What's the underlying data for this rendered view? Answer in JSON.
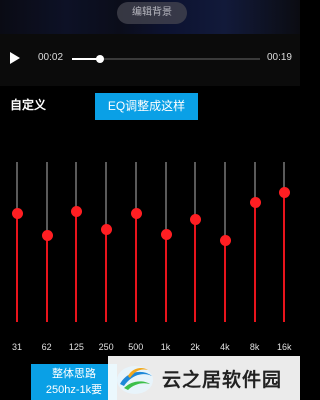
{
  "video": {
    "edit_background_label": "编辑背景"
  },
  "player": {
    "current_time": "00:02",
    "total_time": "00:19",
    "progress": 0.15
  },
  "equalizer": {
    "preset_label": "自定义",
    "max_level": 12,
    "bands": [
      {
        "freq": "31",
        "level": 4.3
      },
      {
        "freq": "62",
        "level": 1.0
      },
      {
        "freq": "125",
        "level": 4.6
      },
      {
        "freq": "250",
        "level": 2.0
      },
      {
        "freq": "500",
        "level": 4.3
      },
      {
        "freq": "1k",
        "level": 1.2
      },
      {
        "freq": "2k",
        "level": 3.5
      },
      {
        "freq": "4k",
        "level": 0.3
      },
      {
        "freq": "8k",
        "level": 6.0
      },
      {
        "freq": "16k",
        "level": 7.5
      }
    ]
  },
  "annotations": {
    "eq_callout": "EQ调整成这样",
    "mid_callout_line1": "整体思路",
    "mid_callout_line2": "250hz-1k要"
  },
  "watermark": {
    "text": "云之居软件园"
  }
}
